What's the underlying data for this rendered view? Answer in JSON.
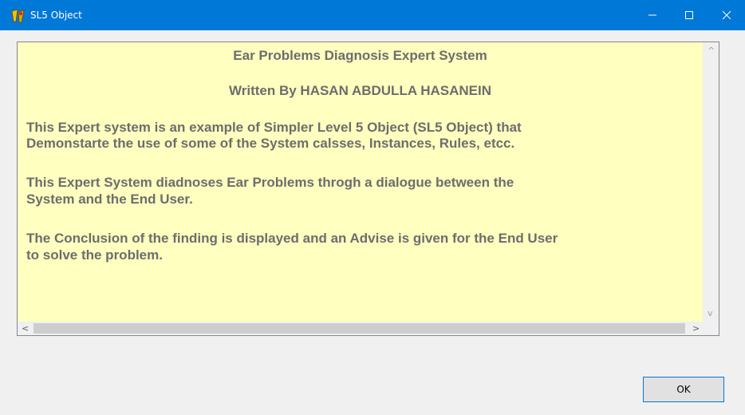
{
  "window": {
    "title": "SL5 Object",
    "app_icon": "sl5-app-icon",
    "controls": {
      "minimize": "minimize-icon",
      "maximize": "maximize-icon",
      "close": "close-icon"
    }
  },
  "content": {
    "heading": "Ear Problems Diagnosis Expert System",
    "author": "Written By HASAN ABDULLA HASANEIN",
    "p1_l1": "This Expert system is an example of Simpler Level 5 Object (SL5 Object) that",
    "p1_l2": "Demonstarte the use of some of the System calsses, Instances, Rules, etcc.",
    "p2_l1": "This Expert System diadnoses Ear Problems throgh a dialogue between the",
    "p2_l2": "System and the End User.",
    "p3_l1": "The Conclusion of the finding is displayed and an Advise is given for the End User",
    "p3_l2": "to solve the problem.",
    "background_color": "#ffffc0",
    "text_color": "#6d6d6d"
  },
  "scrollbars": {
    "up": "^",
    "down": "v",
    "left": "<",
    "right": ">"
  },
  "buttons": {
    "ok_label": "OK"
  },
  "colors": {
    "titlebar": "#0078d7",
    "button_border": "#0078d7"
  }
}
